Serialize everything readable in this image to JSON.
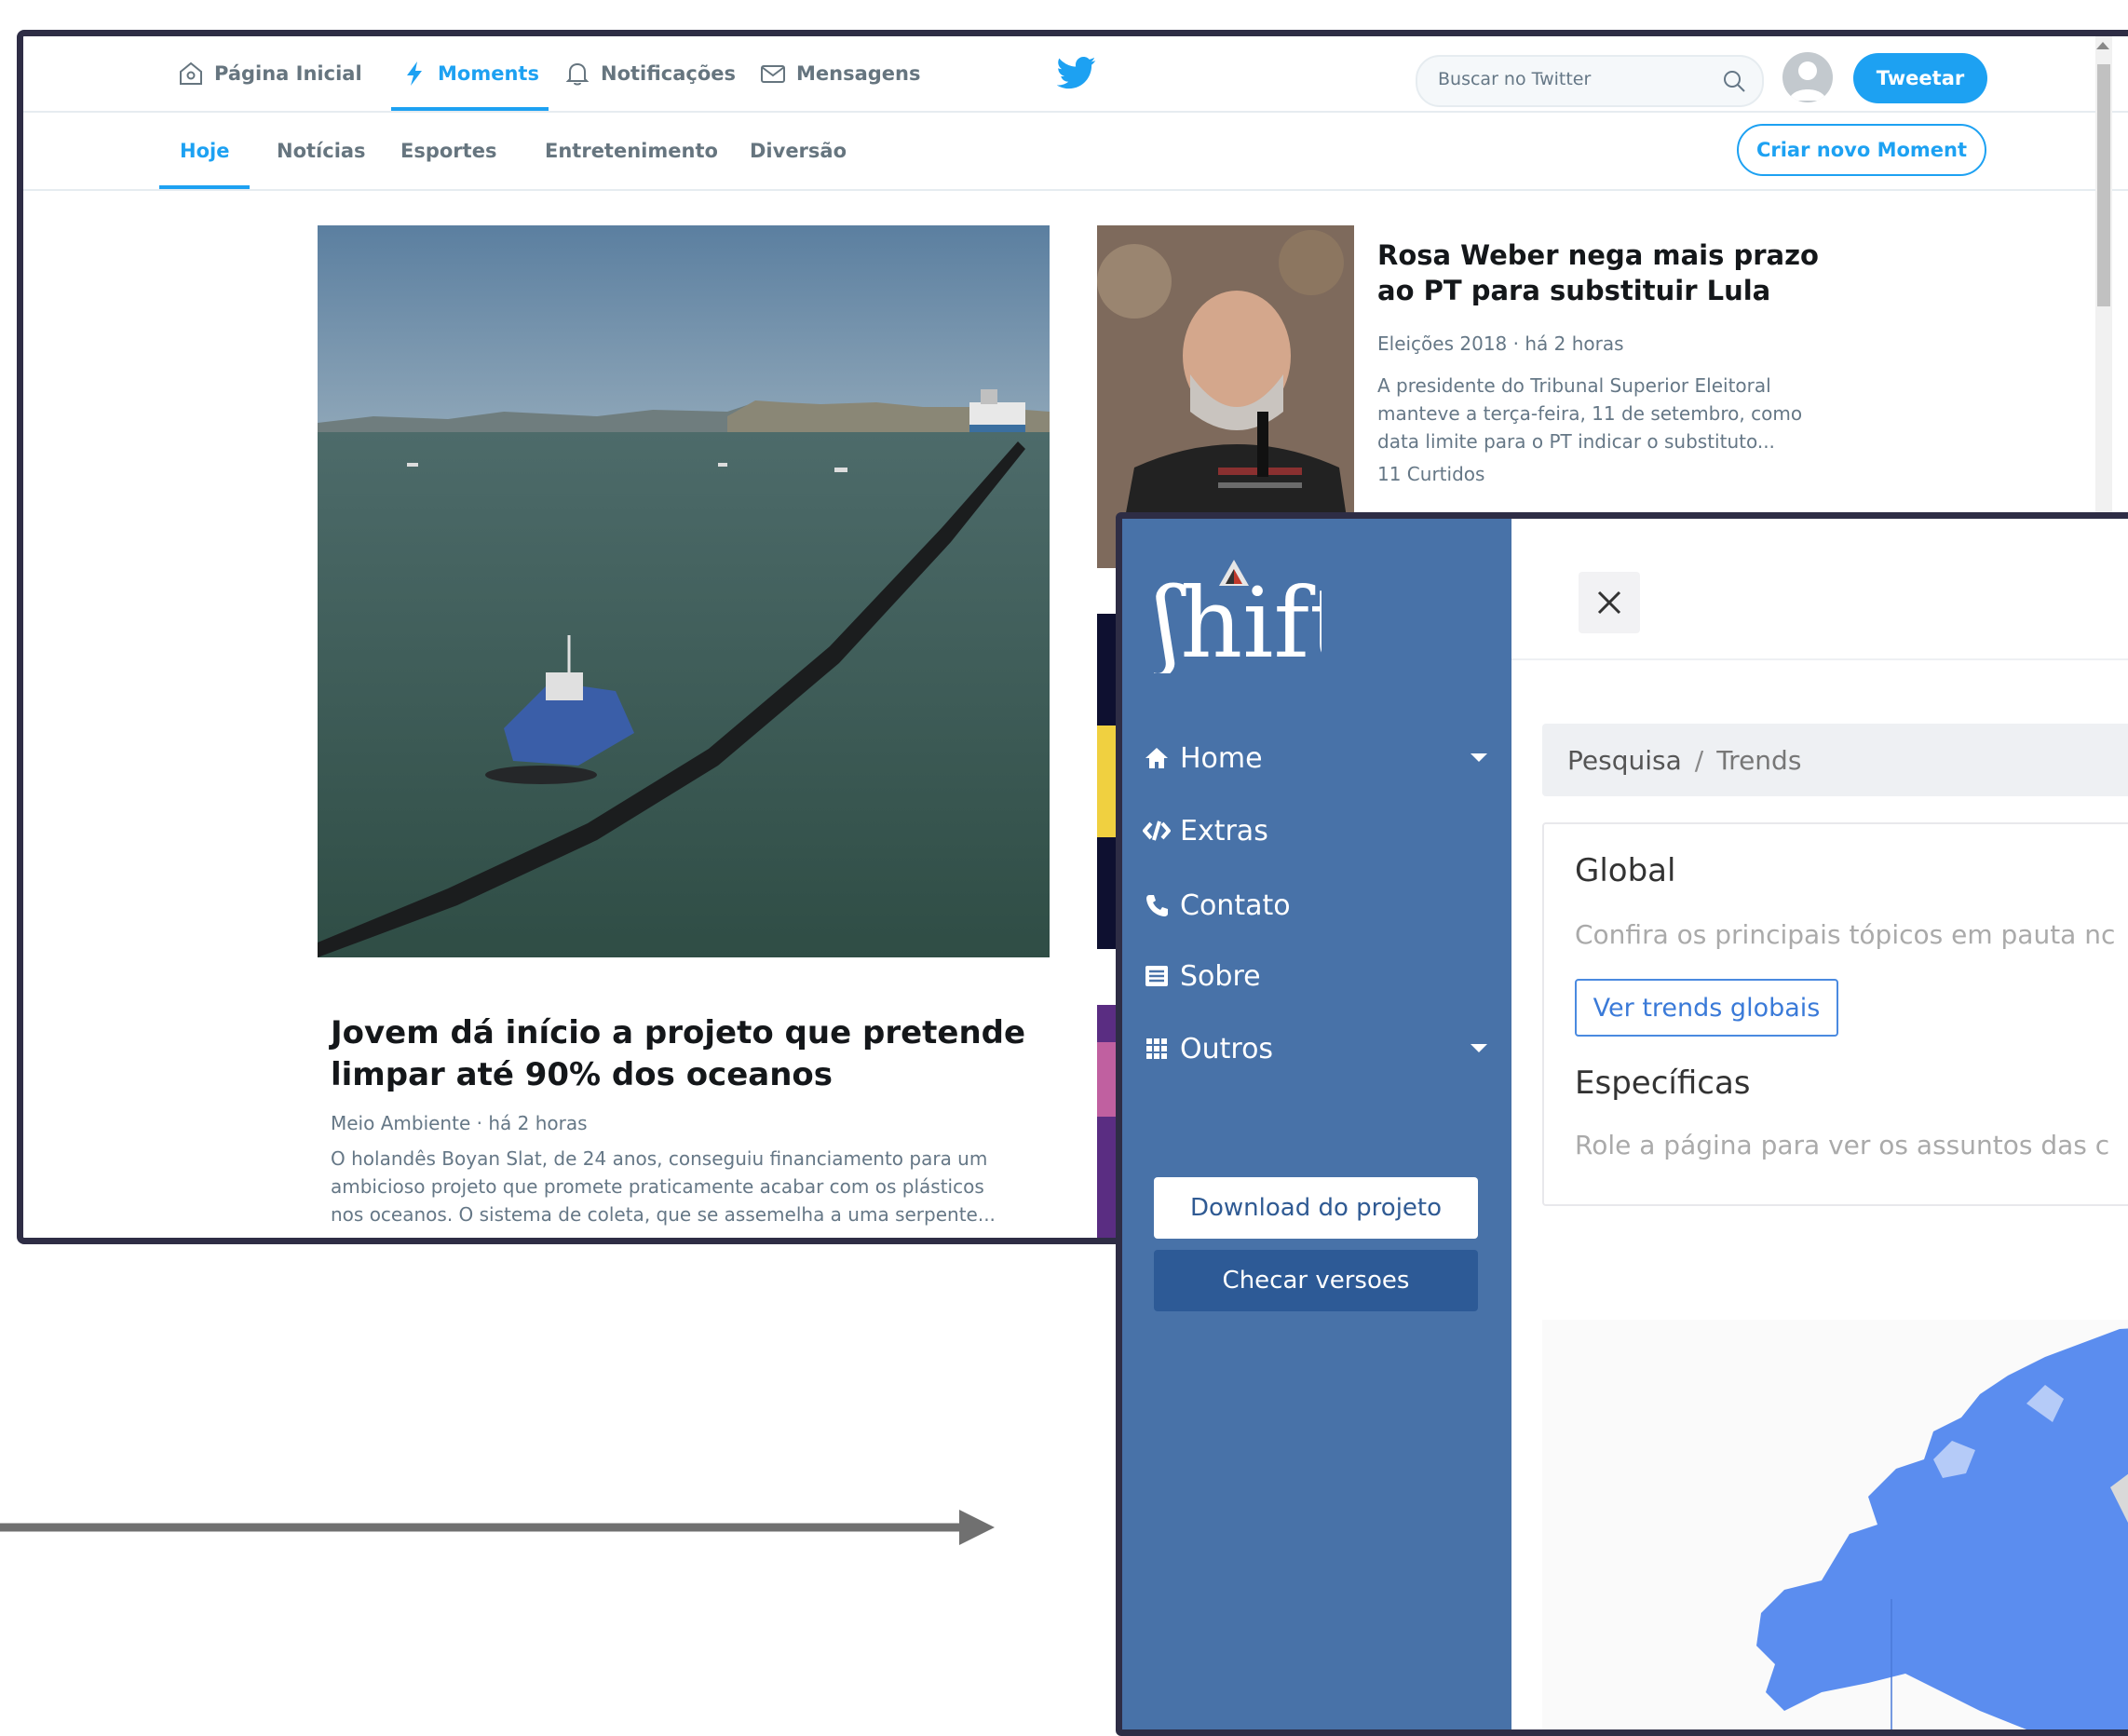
{
  "twitter": {
    "nav": {
      "home": "Página Inicial",
      "moments": "Moments",
      "notifications": "Notificações",
      "messages": "Mensagens"
    },
    "search_placeholder": "Buscar no Twitter",
    "tweet_button": "Tweetar",
    "tabs": [
      "Hoje",
      "Notícias",
      "Esportes",
      "Entretenimento",
      "Diversão"
    ],
    "active_tab": "Hoje",
    "new_moment_button": "Criar novo Moment",
    "main_story": {
      "title": "Jovem dá início a projeto que pretende limpar até 90% dos oceanos",
      "meta": "Meio Ambiente · há 2 horas",
      "description": "O holandês Boyan Slat, de 24 anos, conseguiu financiamento para um ambicioso projeto que promete praticamente acabar com os plásticos nos oceanos. O sistema de coleta, que se assemelha a uma serpente..."
    },
    "side_story": {
      "title": "Rosa Weber nega mais prazo ao PT para substituir Lula",
      "meta": "Eleições 2018 · há 2 horas",
      "description": "A presidente do Tribunal Superior Eleitoral manteve a terça-feira, 11 de setembro, como data limite para o PT indicar o substituto...",
      "likes": "11 Curtidos"
    },
    "accent": "#1da1f2"
  },
  "shift": {
    "logo_text": "ʃhift",
    "menu": [
      {
        "label": "Home",
        "icon": "home-icon",
        "has_caret": true
      },
      {
        "label": "Extras",
        "icon": "code-icon",
        "has_caret": false
      },
      {
        "label": "Contato",
        "icon": "phone-icon",
        "has_caret": false
      },
      {
        "label": "Sobre",
        "icon": "list-icon",
        "has_caret": false
      },
      {
        "label": "Outros",
        "icon": "grid-icon",
        "has_caret": true
      }
    ],
    "download_button": "Download do projeto",
    "versions_button": "Checar versoes",
    "breadcrumb": {
      "root": "Pesquisa",
      "separator": "/",
      "current": "Trends"
    },
    "global_heading": "Global",
    "global_sub": "Confira os principais tópicos em pauta nc",
    "global_button": "Ver trends globais",
    "specific_heading": "Específicas",
    "specific_sub": "Role a página para ver os assuntos das c",
    "sidebar_color": "#4872a8",
    "map_color": "#5b8def"
  }
}
